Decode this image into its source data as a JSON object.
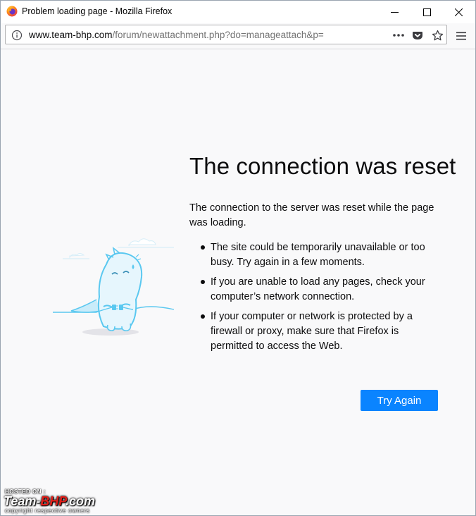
{
  "window": {
    "title": "Problem loading page - Mozilla Firefox",
    "app_icon": "firefox-icon"
  },
  "window_controls": {
    "minimize_icon": "minimize-icon",
    "maximize_icon": "maximize-icon",
    "close_icon": "close-icon"
  },
  "urlbar": {
    "host": "www.team-bhp.com",
    "path": "/forum/newattachment.php?do=manageattach&p=",
    "info_icon": "info-icon",
    "page_actions_icon": "more-dots-icon",
    "pocket_icon": "pocket-icon",
    "bookmark_icon": "star-icon"
  },
  "menu": {
    "icon": "hamburger-icon"
  },
  "error": {
    "title": "The connection was reset",
    "description": "The connection to the server was reset while the page was loading.",
    "bullets": [
      "The site could be temporarily unavailable or too busy. Try again in a few moments.",
      "If you are unable to load any pages, check your computer’s network connection.",
      "If your computer or network is protected by a firewall or proxy, make sure that Firefox is permitted to access the Web."
    ],
    "try_again_label": "Try Again"
  },
  "watermark": {
    "hosted_on": "HOSTED ON :",
    "brand_part1": "Team-",
    "brand_part2": "BHP",
    "brand_part3": ".com",
    "copyright": "copyright respective owners"
  },
  "colors": {
    "accent": "#0a84ff",
    "page_background": "#f9f9fa",
    "text": "#0c0c0d",
    "illustration": "#5ac8f0"
  }
}
